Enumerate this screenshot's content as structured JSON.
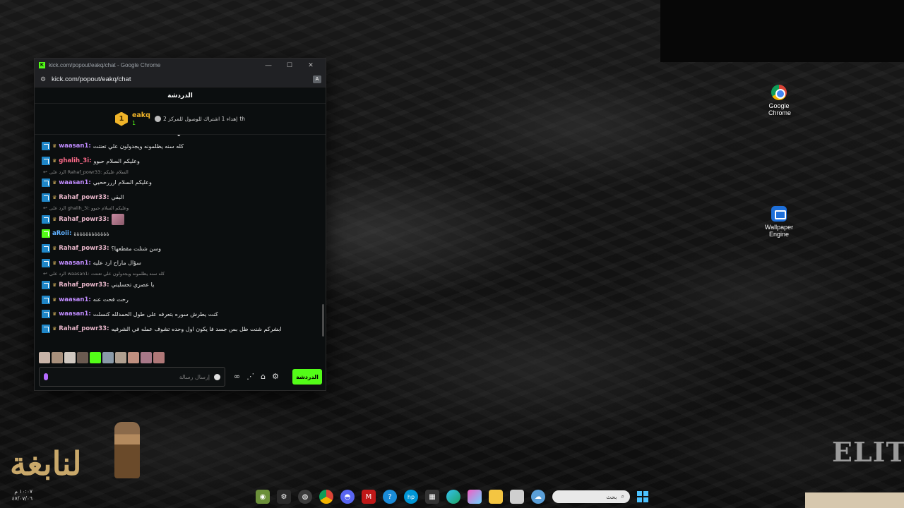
{
  "window": {
    "title": "kick.com/popout/eakq/chat - Google Chrome",
    "url": "kick.com/popout/eakq/chat",
    "minimize": "—",
    "maximize": "☐",
    "close": "✕"
  },
  "chat": {
    "header": "الدردشة",
    "goal": {
      "rank": "1",
      "username": "eakq",
      "count": "1",
      "text": "إهداء 1 اشتراك للوصول للمركز 2",
      "suffix": "th"
    },
    "messages": [
      {
        "type": "msg",
        "user": "waasan1:",
        "text": "كله سنه يظلمونه ويجدولون علي تعنتت",
        "color": "#c18cff"
      },
      {
        "type": "msg",
        "user": "ghalih_3i:",
        "text": "وعليكم السلام حبوو",
        "color": "#ff6b8a"
      },
      {
        "type": "reply",
        "text": "الرد على Rahaf_powr33: السلام عليكم"
      },
      {
        "type": "msg",
        "user": "waasan1:",
        "text": "وعليكم السلام ارررححيي",
        "color": "#c18cff"
      },
      {
        "type": "msg",
        "user": "Rahaf_powr33:",
        "text": "البقي",
        "color": "#e6b5c8"
      },
      {
        "type": "reply",
        "text": "الرد على ghalih_3i: وعليكم السلام حبوو"
      },
      {
        "type": "msg",
        "user": "Rahaf_powr33:",
        "text": "",
        "color": "#e6b5c8",
        "emote": true
      },
      {
        "type": "msg",
        "user": "aRoii:",
        "text": "ةةةةةةةةةةةة",
        "color": "#5fb0ff",
        "green": true
      },
      {
        "type": "msg",
        "user": "Rahaf_powr33:",
        "text": "وسن شنلت مقطعها؟",
        "color": "#e6b5c8"
      },
      {
        "type": "msg",
        "user": "waasan1:",
        "text": "سؤال ماراح ارد عليه",
        "color": "#c18cff"
      },
      {
        "type": "reply",
        "text": "الرد على waasan1: كله سنه يظلمونه ويجدولون علي تعنتت"
      },
      {
        "type": "msg",
        "user": "Rahaf_powr33:",
        "text": "يا عصري تحسليني",
        "color": "#e6b5c8"
      },
      {
        "type": "msg",
        "user": "waasan1:",
        "text": "رحت فحت عنه",
        "color": "#c18cff"
      },
      {
        "type": "msg",
        "user": "waasan1:",
        "text": "كنت يطرش سوره بتعرفه على طول الحمدلله كنسلت",
        "color": "#c18cff"
      },
      {
        "type": "msg",
        "user": "Rahaf_powr33:",
        "text": "ابشركم شنت ظل بس جسد فا يكون اول وحده تشوف عمله في الشرفيه",
        "color": "#e6b5c8"
      }
    ],
    "composer_placeholder": "إرسال رسالة",
    "send_button": "الدردشة",
    "emote_colors": [
      "#c8b4a8",
      "#a8907c",
      "#d0c8c0",
      "#6a5a50",
      "#53fc18",
      "#8a9aa8",
      "#b0a090",
      "#c09080",
      "#a87888",
      "#b07878"
    ]
  },
  "desktop": {
    "icons": [
      {
        "label": "Google Chrome",
        "label2": ""
      },
      {
        "label": "Wallpaper",
        "label2": "Engine"
      }
    ]
  },
  "clock": {
    "time": "١٠:٠٧ م",
    "date": "٤٧/٠٧/٠٦"
  },
  "taskbar": {
    "search_placeholder": "بحث"
  }
}
